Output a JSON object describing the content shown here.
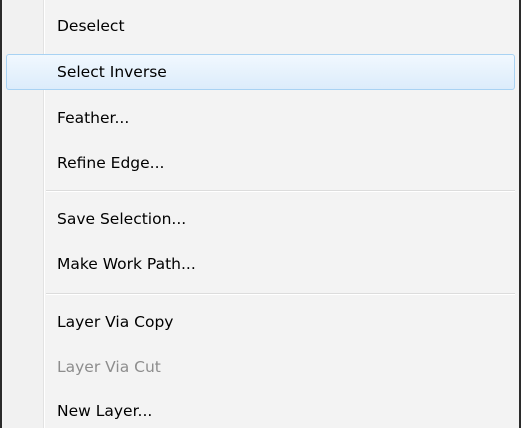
{
  "menu": {
    "items": [
      {
        "label": "Deselect",
        "enabled": true,
        "highlighted": false
      },
      {
        "label": "Select Inverse",
        "enabled": true,
        "highlighted": true
      },
      {
        "label": "Feather...",
        "enabled": true,
        "highlighted": false
      },
      {
        "label": "Refine Edge...",
        "enabled": true,
        "highlighted": false
      },
      {
        "label": "Save Selection...",
        "enabled": true,
        "highlighted": false
      },
      {
        "label": "Make Work Path...",
        "enabled": true,
        "highlighted": false
      },
      {
        "label": "Layer Via Copy",
        "enabled": true,
        "highlighted": false
      },
      {
        "label": "Layer Via Cut",
        "enabled": false,
        "highlighted": false
      },
      {
        "label": "New Layer...",
        "enabled": true,
        "highlighted": false
      }
    ]
  },
  "colors": {
    "highlight_border": "#a8d2f3",
    "disabled_text": "#8d8d8d",
    "menu_background": "#f3f3f3"
  }
}
